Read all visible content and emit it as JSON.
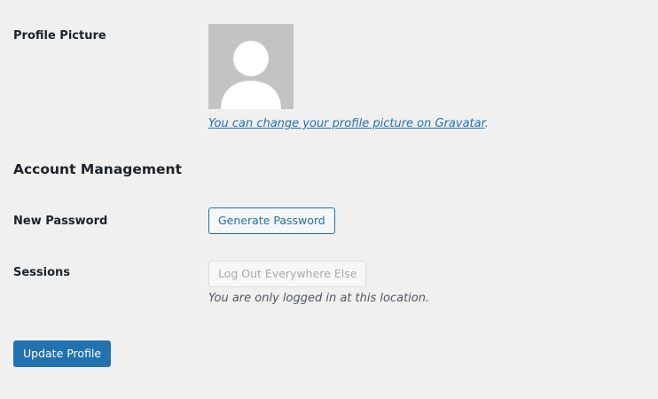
{
  "profile_picture": {
    "label": "Profile Picture",
    "avatar_icon": "default-person-avatar",
    "gravatar_link_text": "You can change your profile picture on Gravatar",
    "gravatar_suffix": "."
  },
  "account_management": {
    "heading": "Account Management",
    "new_password": {
      "label": "New Password",
      "button_label": "Generate Password"
    },
    "sessions": {
      "label": "Sessions",
      "button_label": "Log Out Everywhere Else",
      "button_disabled": true,
      "note": "You are only logged in at this location."
    }
  },
  "actions": {
    "update_label": "Update Profile"
  },
  "colors": {
    "background": "#f0f0f1",
    "accent": "#2271b1",
    "text": "#1d2327",
    "muted_text": "#50575e",
    "avatar_bg": "#c3c3c3"
  }
}
